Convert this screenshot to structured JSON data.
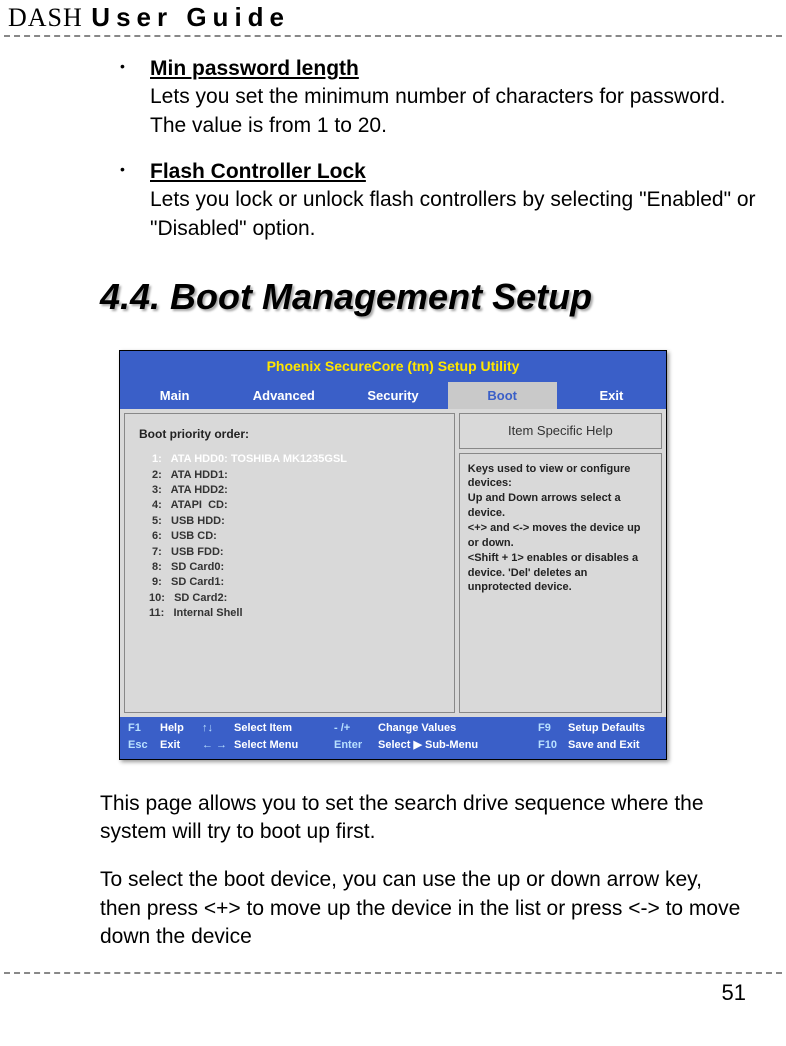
{
  "header": {
    "brand_dash": "DASH",
    "brand_ug": "User Guide"
  },
  "bullets": [
    {
      "title": "Min password length",
      "body": "Lets you set the minimum number of characters for password. The value is from 1 to 20."
    },
    {
      "title": "Flash Controller Lock",
      "body": "Lets you lock or unlock flash controllers by selecting \"Enabled\" or \"Disabled\" option."
    }
  ],
  "section_heading": "4.4. Boot Management Setup",
  "bios": {
    "title": "Phoenix SecureCore (tm) Setup Utility",
    "tabs": [
      "Main",
      "Advanced",
      "Security",
      "Boot",
      "Exit"
    ],
    "active_tab_index": 3,
    "boot_label": "Boot priority order:",
    "boot_items": [
      {
        "num": "1:",
        "label": "ATA HDD0: TOSHIBA MK1235GSL",
        "selected": true
      },
      {
        "num": "2:",
        "label": "ATA HDD1:",
        "selected": false
      },
      {
        "num": "3:",
        "label": "ATA HDD2:",
        "selected": false
      },
      {
        "num": "4:",
        "label": "ATAPI  CD:",
        "selected": false
      },
      {
        "num": "5:",
        "label": "USB HDD:",
        "selected": false
      },
      {
        "num": "6:",
        "label": "USB CD:",
        "selected": false
      },
      {
        "num": "7:",
        "label": "USB FDD:",
        "selected": false
      },
      {
        "num": "8:",
        "label": "SD Card0:",
        "selected": false
      },
      {
        "num": "9:",
        "label": "SD Card1:",
        "selected": false
      },
      {
        "num": "10:",
        "label": "SD Card2:",
        "selected": false
      },
      {
        "num": "11:",
        "label": "Internal Shell",
        "selected": false
      }
    ],
    "help_title": "Item Specific Help",
    "help_body": "Keys used to view or configure devices:\nUp  and Down arrows select a device.\n<+> and <-> moves the device up or down.\n<Shift + 1> enables or disables a device. 'Del' deletes an unprotected device.",
    "footer": {
      "r1c1": "F1",
      "r1c2": "Help",
      "r1c3": "↑↓",
      "r1c4": "Select Item",
      "r1c5": "- /+",
      "r1c6": "Change Values",
      "r1c7": "F9",
      "r1c8": "Setup Defaults",
      "r2c1": "Esc",
      "r2c2": "Exit",
      "r2c3": "← →",
      "r2c4": "Select Menu",
      "r2c5": "Enter",
      "r2c6": "Select  ▶  Sub-Menu",
      "r2c7": "F10",
      "r2c8": "Save and Exit"
    }
  },
  "paragraphs": {
    "p1": "This page allows you to set the search drive sequence where the system will try to boot up first.",
    "p2": "To select the boot device, you can use the up or down arrow key, then press <+> to move up the device in the list or press <-> to move down the device"
  },
  "page_number": "51"
}
